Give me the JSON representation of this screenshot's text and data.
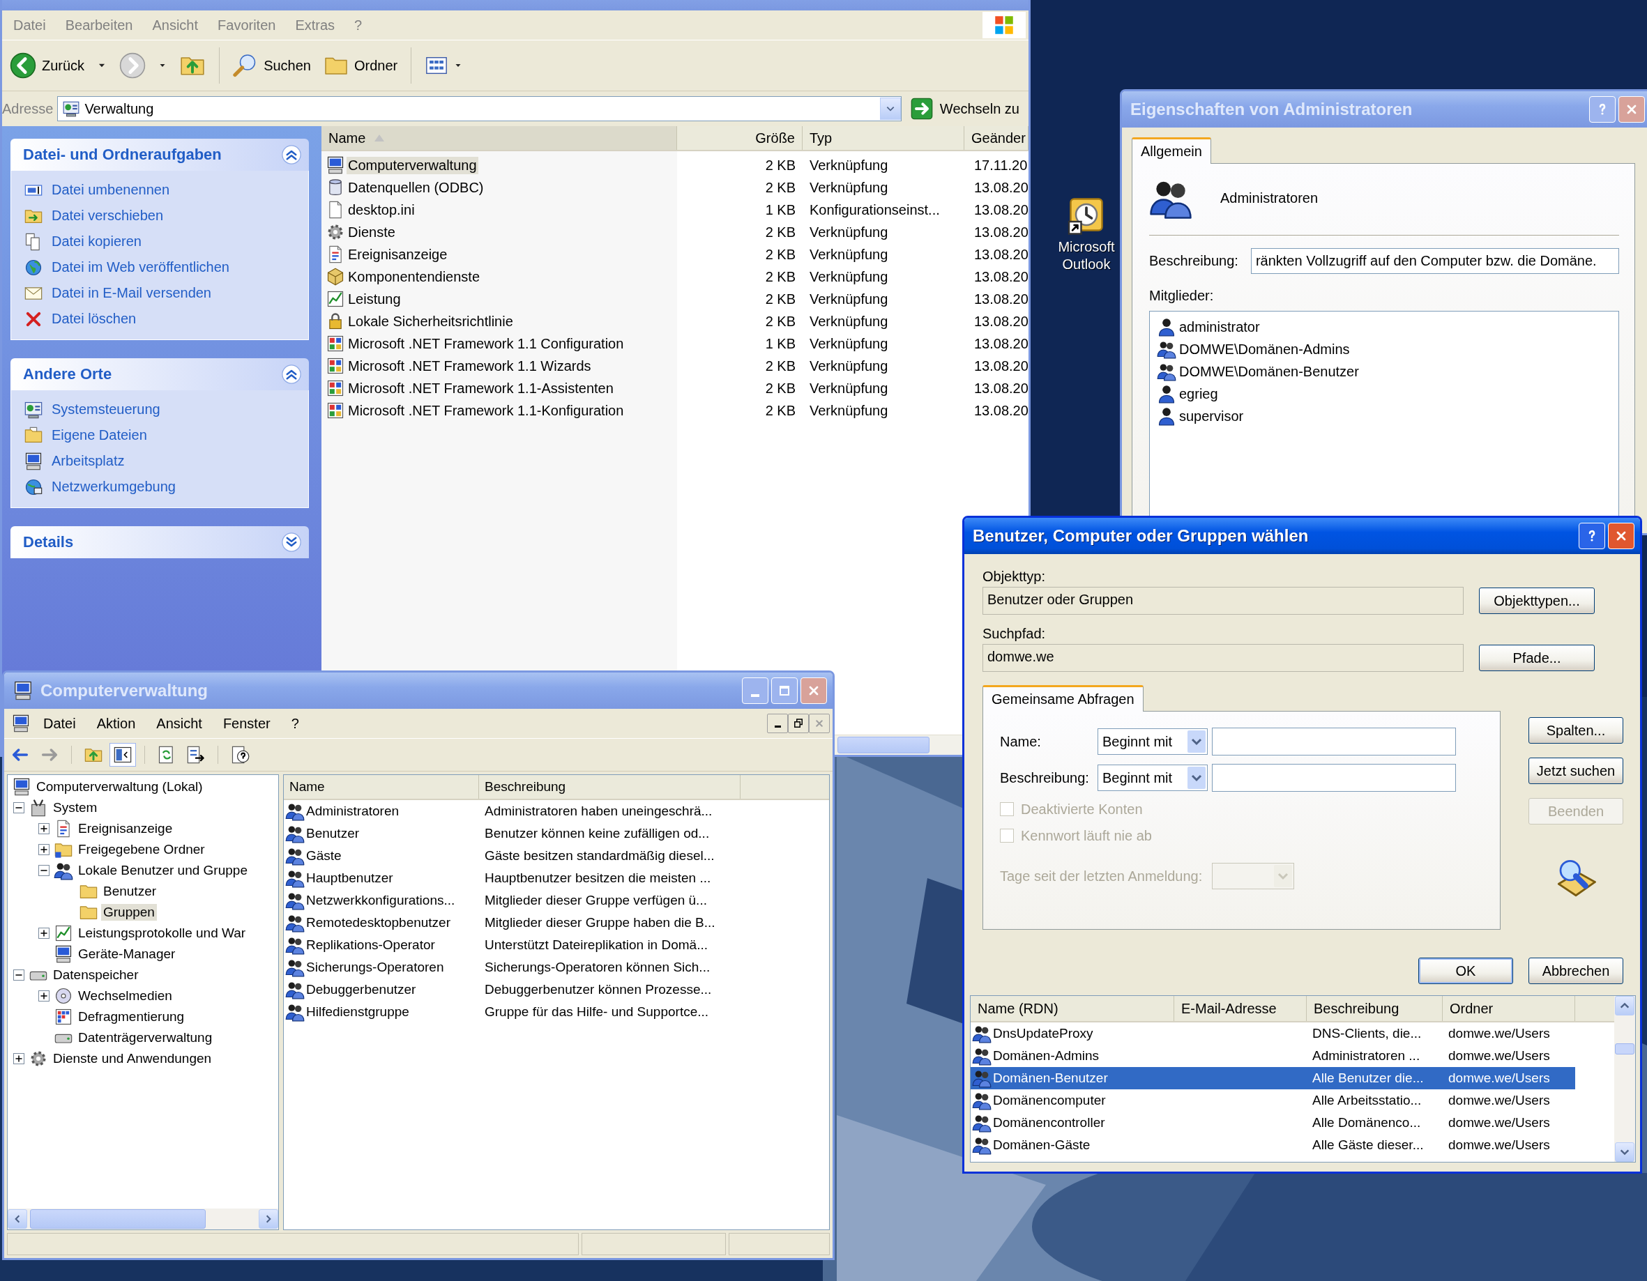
{
  "explorer": {
    "menu": [
      "Datei",
      "Bearbeiten",
      "Ansicht",
      "Favoriten",
      "Extras",
      "?"
    ],
    "toolbar": {
      "back": "Zurück",
      "search": "Suchen",
      "folders": "Ordner"
    },
    "address": {
      "label": "Adresse",
      "value": "Verwaltung",
      "go": "Wechseln zu"
    },
    "panels": [
      {
        "title": "Datei- und Ordneraufgaben",
        "expanded": true,
        "items": [
          {
            "label": "Datei umbenennen",
            "kind": "rename"
          },
          {
            "label": "Datei verschieben",
            "kind": "move"
          },
          {
            "label": "Datei kopieren",
            "kind": "copy"
          },
          {
            "label": "Datei im Web veröffentlichen",
            "kind": "globe"
          },
          {
            "label": "Datei in E-Mail versenden",
            "kind": "mail"
          },
          {
            "label": "Datei löschen",
            "kind": "delete"
          }
        ]
      },
      {
        "title": "Andere Orte",
        "expanded": true,
        "items": [
          {
            "label": "Systemsteuerung",
            "kind": "panel"
          },
          {
            "label": "Eigene Dateien",
            "kind": "docs"
          },
          {
            "label": "Arbeitsplatz",
            "kind": "computer"
          },
          {
            "label": "Netzwerkumgebung",
            "kind": "network"
          }
        ]
      },
      {
        "title": "Details",
        "expanded": false
      }
    ],
    "columns": [
      {
        "label": "Name",
        "sorted": true
      },
      {
        "label": "Größe",
        "sorted": false
      },
      {
        "label": "Typ",
        "sorted": false
      },
      {
        "label": "Geänder",
        "sorted": false
      }
    ],
    "files": [
      {
        "name": "Computerverwaltung",
        "size": "2 KB",
        "type": "Verknüpfung",
        "date": "17.11.20",
        "kind": "computer",
        "selected": true
      },
      {
        "name": "Datenquellen (ODBC)",
        "size": "2 KB",
        "type": "Verknüpfung",
        "date": "13.08.20",
        "kind": "database",
        "selected": false
      },
      {
        "name": "desktop.ini",
        "size": "1 KB",
        "type": "Konfigurationseinst...",
        "date": "13.08.20",
        "kind": "document",
        "selected": false
      },
      {
        "name": "Dienste",
        "size": "2 KB",
        "type": "Verknüpfung",
        "date": "13.08.20",
        "kind": "gear",
        "selected": false
      },
      {
        "name": "Ereignisanzeige",
        "size": "2 KB",
        "type": "Verknüpfung",
        "date": "13.08.20",
        "kind": "log",
        "selected": false
      },
      {
        "name": "Komponentendienste",
        "size": "2 KB",
        "type": "Verknüpfung",
        "date": "13.08.20",
        "kind": "box",
        "selected": false
      },
      {
        "name": "Leistung",
        "size": "2 KB",
        "type": "Verknüpfung",
        "date": "13.08.20",
        "kind": "chart",
        "selected": false
      },
      {
        "name": "Lokale Sicherheitsrichtlinie",
        "size": "2 KB",
        "type": "Verknüpfung",
        "date": "13.08.20",
        "kind": "lock",
        "selected": false
      },
      {
        "name": "Microsoft .NET Framework 1.1 Configuration",
        "size": "1 KB",
        "type": "Verknüpfung",
        "date": "13.08.20",
        "kind": "app",
        "selected": false
      },
      {
        "name": "Microsoft .NET Framework 1.1 Wizards",
        "size": "2 KB",
        "type": "Verknüpfung",
        "date": "13.08.20",
        "kind": "app",
        "selected": false
      },
      {
        "name": "Microsoft .NET Framework 1.1-Assistenten",
        "size": "2 KB",
        "type": "Verknüpfung",
        "date": "13.08.20",
        "kind": "app",
        "selected": false
      },
      {
        "name": "Microsoft .NET Framework 1.1-Konfiguration",
        "size": "2 KB",
        "type": "Verknüpfung",
        "date": "13.08.20",
        "kind": "app",
        "selected": false
      }
    ]
  },
  "desktop_icons": [
    {
      "label": "Microsoft Outlook"
    }
  ],
  "properties_dialog": {
    "title": "Eigenschaften von Administratoren",
    "active": false,
    "tabs": [
      {
        "label": "Allgemein",
        "selected": true
      }
    ],
    "name": "Administratoren",
    "description_label": "Beschreibung:",
    "description": "ränkten Vollzugriff auf den Computer bzw. die Domäne.",
    "members_label": "Mitglieder:",
    "members": [
      {
        "name": "administrator",
        "kind": "user"
      },
      {
        "name": "DOMWE\\Domänen-Admins",
        "kind": "group"
      },
      {
        "name": "DOMWE\\Domänen-Benutzer",
        "kind": "group"
      },
      {
        "name": "egrieg",
        "kind": "user"
      },
      {
        "name": "supervisor",
        "kind": "user"
      }
    ]
  },
  "select_dialog": {
    "title": "Benutzer, Computer oder Gruppen wählen",
    "active": true,
    "object_type": {
      "label": "Objekttyp:",
      "value": "Benutzer oder Gruppen",
      "button": "Objekttypen..."
    },
    "search_path": {
      "label": "Suchpfad:",
      "value": "domwe.we",
      "button": "Pfade..."
    },
    "tabs": [
      {
        "label": "Gemeinsame Abfragen",
        "selected": true
      }
    ],
    "query": {
      "name_label": "Name:",
      "name_mode": "Beginnt mit",
      "description_label": "Beschreibung:",
      "description_mode": "Beginnt mit",
      "checkboxes": [
        {
          "label": "Deaktivierte Konten",
          "checked": false,
          "disabled": true
        },
        {
          "label": "Kennwort läuft nie ab",
          "checked": false,
          "disabled": true
        }
      ],
      "days": {
        "label": "Tage seit der letzten Anmeldung:",
        "disabled": true
      }
    },
    "side_buttons": [
      {
        "label": "Spalten...",
        "disabled": false
      },
      {
        "label": "Jetzt suchen",
        "disabled": false
      },
      {
        "label": "Beenden",
        "disabled": true
      }
    ],
    "buttons": [
      {
        "label": "OK",
        "default": true
      },
      {
        "label": "Abbrechen",
        "default": false
      }
    ],
    "results": {
      "columns": [
        "Name (RDN)",
        "E-Mail-Adresse",
        "Beschreibung",
        "Ordner"
      ],
      "rows": [
        {
          "name": "DnsUpdateProxy",
          "description": "DNS-Clients, die...",
          "folder": "domwe.we/Users",
          "selected": false
        },
        {
          "name": "Domänen-Admins",
          "description": "Administratoren ...",
          "folder": "domwe.we/Users",
          "selected": false
        },
        {
          "name": "Domänen-Benutzer",
          "description": "Alle Benutzer die...",
          "folder": "domwe.we/Users",
          "selected": true
        },
        {
          "name": "Domänencomputer",
          "description": "Alle Arbeitsstatio...",
          "folder": "domwe.we/Users",
          "selected": false
        },
        {
          "name": "Domänencontroller",
          "description": "Alle Domänenco...",
          "folder": "domwe.we/Users",
          "selected": false
        },
        {
          "name": "Domänen-Gäste",
          "description": "Alle Gäste dieser...",
          "folder": "domwe.we/Users",
          "selected": false
        }
      ]
    }
  },
  "computer_management": {
    "title": "Computerverwaltung",
    "active": false,
    "menu": [
      "Datei",
      "Aktion",
      "Ansicht",
      "Fenster",
      "?"
    ],
    "tree": [
      {
        "label": "Computerverwaltung (Lokal)",
        "kind": "computer",
        "selected": false,
        "children": [
          {
            "label": "System",
            "kind": "tools",
            "expanded": true,
            "selected": false,
            "children": [
              {
                "label": "Ereignisanzeige",
                "kind": "log",
                "expanded": false,
                "selected": false
              },
              {
                "label": "Freigegebene Ordner",
                "kind": "share",
                "expanded": false,
                "selected": false
              },
              {
                "label": "Lokale Benutzer und Gruppe",
                "kind": "group",
                "expanded": true,
                "selected": false,
                "children": [
                  {
                    "label": "Benutzer",
                    "kind": "folder",
                    "selected": false
                  },
                  {
                    "label": "Gruppen",
                    "kind": "folder",
                    "selected": true
                  }
                ]
              },
              {
                "label": "Leistungsprotokolle und War",
                "kind": "chart",
                "expanded": false,
                "selected": false
              },
              {
                "label": "Geräte-Manager",
                "kind": "computer",
                "selected": false
              }
            ]
          },
          {
            "label": "Datenspeicher",
            "kind": "drive",
            "expanded": true,
            "selected": false,
            "children": [
              {
                "label": "Wechselmedien",
                "kind": "disc",
                "expanded": false,
                "selected": false
              },
              {
                "label": "Defragmentierung",
                "kind": "defrag",
                "selected": false
              },
              {
                "label": "Datenträgerverwaltung",
                "kind": "drive",
                "selected": false
              }
            ]
          },
          {
            "label": "Dienste und Anwendungen",
            "kind": "gear",
            "expanded": false,
            "selected": false
          }
        ]
      }
    ],
    "columns": [
      "Name",
      "Beschreibung"
    ],
    "rows": [
      {
        "name": "Administratoren",
        "description": "Administratoren haben uneingeschrä..."
      },
      {
        "name": "Benutzer",
        "description": "Benutzer können keine zufälligen od..."
      },
      {
        "name": "Gäste",
        "description": "Gäste besitzen standardmäßig diesel..."
      },
      {
        "name": "Hauptbenutzer",
        "description": "Hauptbenutzer besitzen die meisten ..."
      },
      {
        "name": "Netzwerkkonfigurations...",
        "description": "Mitglieder dieser Gruppe verfügen ü..."
      },
      {
        "name": "Remotedesktopbenutzer",
        "description": "Mitglieder dieser Gruppe haben die B..."
      },
      {
        "name": "Replikations-Operator",
        "description": "Unterstützt Dateireplikation in Domä..."
      },
      {
        "name": "Sicherungs-Operatoren",
        "description": "Sicherungs-Operatoren können Sich..."
      },
      {
        "name": "Debuggerbenutzer",
        "description": "Debuggerbenutzer können Prozesse..."
      },
      {
        "name": "Hilfedienstgruppe",
        "description": "Gruppe für das Hilfe- und Supportce..."
      }
    ]
  }
}
